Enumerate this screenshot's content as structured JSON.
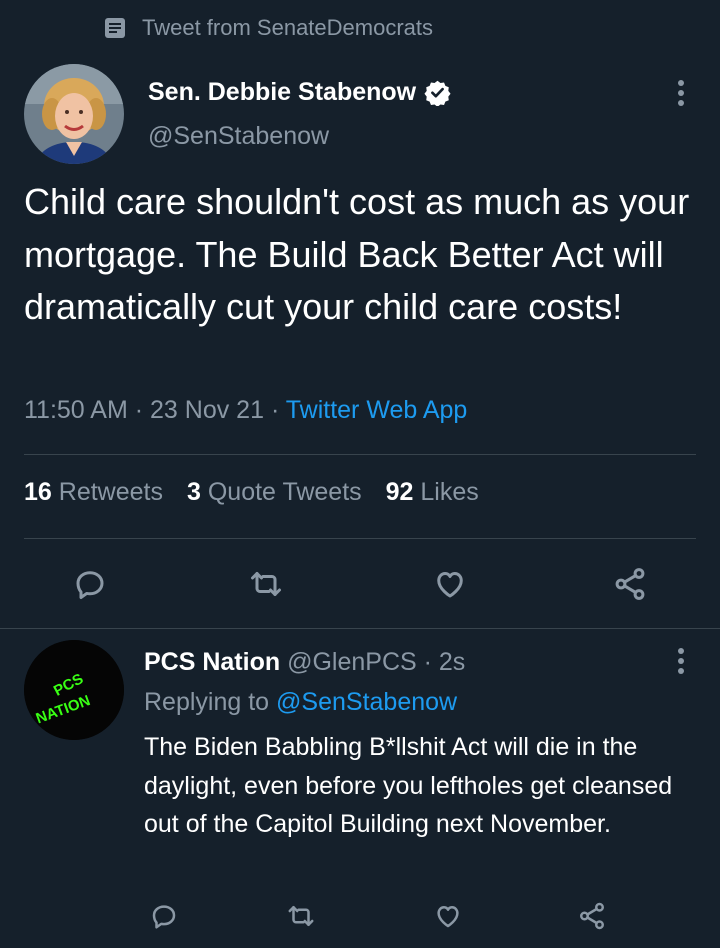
{
  "context": {
    "label": "Tweet from SenateDemocrats",
    "icon": "document-icon"
  },
  "tweet": {
    "author_name": "Sen. Debbie Stabenow",
    "author_handle": "@SenStabenow",
    "verified": true,
    "text": "Child care shouldn't cost as much as your mortgage. The Build Back Better Act will dramatically cut your child care costs!",
    "time": "11:50 AM",
    "date": "23 Nov 21",
    "separator": "·",
    "source": "Twitter Web App",
    "stats": {
      "retweets_count": "16",
      "retweets_label": "Retweets",
      "quotes_count": "3",
      "quotes_label": "Quote Tweets",
      "likes_count": "92",
      "likes_label": "Likes"
    }
  },
  "reply": {
    "name": "PCS Nation",
    "handle": "@GlenPCS",
    "separator": "·",
    "age": "2s",
    "replying_prefix": "Replying to",
    "replying_to": "@SenStabenow",
    "text": "The Biden Babbling B*llshit Act will die in the daylight, even before you leftholes get cleansed out of the Capitol Building next November.",
    "avatar_text_top": "PCS",
    "avatar_text_bottom": "NATION"
  },
  "colors": {
    "background": "#15202b",
    "text": "#ffffff",
    "secondary": "#8b98a5",
    "accent": "#1d9bf0",
    "divider": "#38444d",
    "avatar_logo": "#39ff14"
  }
}
